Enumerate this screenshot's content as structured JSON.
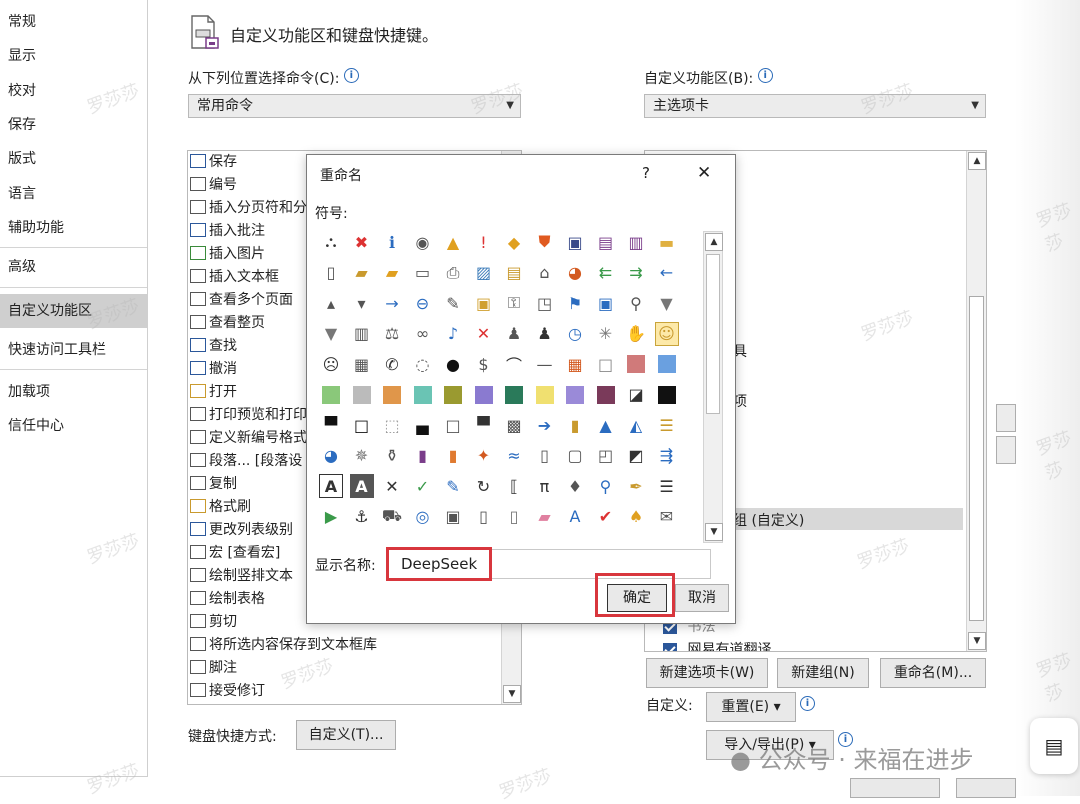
{
  "sidebar": {
    "items": [
      "常规",
      "显示",
      "校对",
      "保存",
      "版式",
      "语言",
      "辅助功能",
      "高级",
      "自定义功能区",
      "快速访问工具栏",
      "加载项",
      "信任中心"
    ],
    "active_index": 8
  },
  "header": {
    "title": "自定义功能区和键盘快捷键。"
  },
  "left_panel": {
    "label": "从下列位置选择命令(C):",
    "combo_value": "常用命令",
    "commands": [
      "保存",
      "编号",
      "插入分页符和分",
      "插入批注",
      "插入图片",
      "插入文本框",
      "查看多个页面",
      "查看整页",
      "查找",
      "撤消",
      "打开",
      "打印预览和打印",
      "定义新编号格式",
      "段落... [段落设",
      "复制",
      "格式刷",
      "更改列表级别",
      "宏 [查看宏]",
      "绘制竖排文本",
      "绘制表格",
      "剪切",
      "将所选内容保存到文本框库",
      "脚注",
      "接受修订"
    ],
    "keyboard_label": "键盘快捷方式:",
    "keyboard_button": "自定义(T)..."
  },
  "right_panel": {
    "label": "自定义功能区(B):",
    "combo_value": "主选项卡",
    "partial_items": [
      "具",
      "项",
      "组 (自定义)"
    ],
    "tree_items": [
      "书法",
      "网易有道翻译"
    ],
    "buttons": {
      "new_tab": "新建选项卡(W)",
      "new_group": "新建组(N)",
      "rename": "重命名(M)..."
    },
    "customize_label": "自定义:",
    "reset_button": "重置(E) ▾",
    "import_export_button": "导入/导出(P) ▾"
  },
  "dialog": {
    "title": "重命名",
    "help": "?",
    "close": "✕",
    "symbol_label": "符号:",
    "display_name_label": "显示名称:",
    "display_name_value": "DeepSeek",
    "ok": "确定",
    "cancel": "取消",
    "symbol_rows": [
      [
        "sitemap",
        "x-circle",
        "info",
        "record",
        "warning",
        "exclaim",
        "diamond-warn",
        "shield",
        "floppy",
        "save-as",
        "export",
        "folder"
      ],
      [
        "blank-page",
        "open-folder",
        "folders",
        "printer-tray",
        "printer",
        "picture",
        "clipboard",
        "home",
        "pie",
        "back-green",
        "forward-green",
        "left-blue"
      ],
      [
        "up-tri",
        "down-tri",
        "right-arrow",
        "left-circle",
        "pin",
        "lock",
        "key",
        "page-fold",
        "flag",
        "window",
        "magnifier",
        "funnel"
      ],
      [
        "funnel2",
        "book",
        "scales",
        "rings",
        "mic",
        "mute",
        "user-tie",
        "user",
        "clock",
        "sparkle",
        "hand",
        "smiley"
      ],
      [
        "frown",
        "calculator",
        "phone",
        "piggy",
        "ball",
        "dollar",
        "eye",
        "dash",
        "grid",
        "empty-sq",
        "red-sq",
        "blue-sq"
      ],
      [
        "green-sq",
        "gray-sq",
        "orange-sq",
        "teal-sq",
        "olive-sq",
        "purple-sq",
        "dkgreen-sq",
        "yellow-sq",
        "violet-sq",
        "maroon-sq",
        "half-sq",
        "black-sq"
      ],
      [
        "bar-sq",
        "outline-sq",
        "dotted-sq",
        "lower-sq",
        "thin-sq",
        "top-sq",
        "checker",
        "arrow-circle",
        "bar-chart",
        "pyramid",
        "mountain",
        "stack"
      ],
      [
        "pie2",
        "web",
        "cylinders",
        "purple-book",
        "orange-book",
        "colors",
        "wave",
        "page2",
        "pages",
        "copy-page",
        "diag-sq",
        "arrows-split"
      ],
      [
        "text-A",
        "text-A-dark",
        "cross",
        "check",
        "chart-edit",
        "refresh",
        "brackets",
        "pi",
        "bucket",
        "search",
        "brush",
        "list"
      ],
      [
        "play",
        "anchor",
        "truck",
        "shapes",
        "files",
        "page3",
        "page4",
        "eraser",
        "italic-A",
        "shield-color",
        "bell",
        "envelope"
      ]
    ]
  },
  "watermark": {
    "text": "罗莎莎"
  },
  "footer_watermark": "公众号 · 来福在进步",
  "colors": {
    "accent": "#2b579a",
    "highlight": "#d8363d",
    "selected": "#fde9a8"
  }
}
